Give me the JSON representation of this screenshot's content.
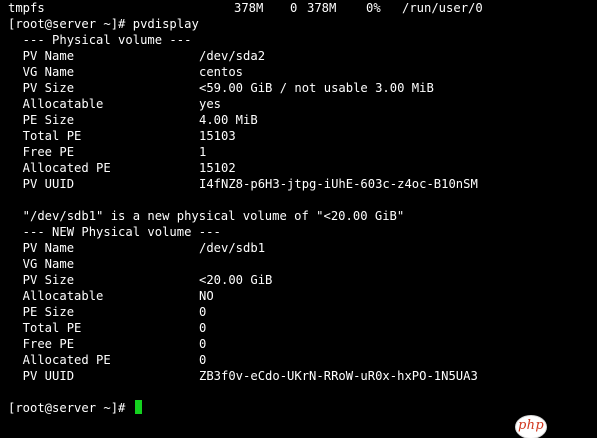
{
  "df_tail": {
    "filesystem": "tmpfs",
    "size": "378M",
    "used": "0",
    "avail": "378M",
    "use_pct": "0%",
    "mount": "/run/user/0"
  },
  "prompt": "[root@server ~]# ",
  "command": "pvdisplay",
  "pv1": {
    "header": "  --- Physical volume ---",
    "fields": [
      {
        "label": "  PV Name",
        "value": "/dev/sda2"
      },
      {
        "label": "  VG Name",
        "value": "centos"
      },
      {
        "label": "  PV Size",
        "value": "<59.00 GiB / not usable 3.00 MiB"
      },
      {
        "label": "  Allocatable",
        "value": "yes"
      },
      {
        "label": "  PE Size",
        "value": "4.00 MiB"
      },
      {
        "label": "  Total PE",
        "value": "15103"
      },
      {
        "label": "  Free PE",
        "value": "1"
      },
      {
        "label": "  Allocated PE",
        "value": "15102"
      },
      {
        "label": "  PV UUID",
        "value": "I4fNZ8-p6H3-jtpg-iUhE-603c-z4oc-B10nSM"
      }
    ]
  },
  "notice": "  \"/dev/sdb1\" is a new physical volume of \"<20.00 GiB\"",
  "pv2": {
    "header": "  --- NEW Physical volume ---",
    "fields": [
      {
        "label": "  PV Name",
        "value": "/dev/sdb1"
      },
      {
        "label": "  VG Name",
        "value": ""
      },
      {
        "label": "  PV Size",
        "value": "<20.00 GiB"
      },
      {
        "label": "  Allocatable",
        "value": "NO"
      },
      {
        "label": "  PE Size",
        "value": "0"
      },
      {
        "label": "  Total PE",
        "value": "0"
      },
      {
        "label": "  Free PE",
        "value": "0"
      },
      {
        "label": "  Allocated PE",
        "value": "0"
      },
      {
        "label": "  PV UUID",
        "value": "ZB3f0v-eCdo-UKrN-RRoW-uR0x-hxPO-1N5UA3"
      }
    ]
  },
  "final_prompt": "[root@server ~]# ",
  "colors": {
    "background": "#000000",
    "foreground": "#ffffff",
    "cursor": "#14d11f",
    "watermark_text": "#d1381f"
  },
  "watermark": {
    "text": "php"
  }
}
